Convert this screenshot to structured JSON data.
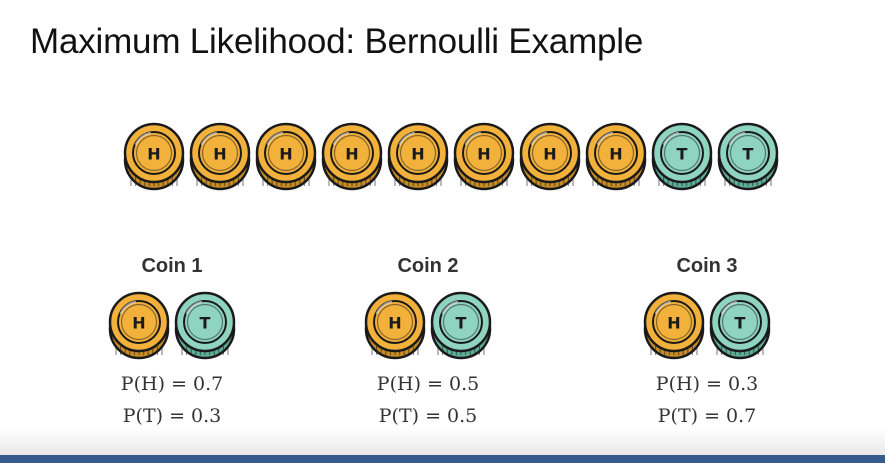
{
  "title": "Maximum Likelihood: Bernoulli Example",
  "sequence": [
    "H",
    "H",
    "H",
    "H",
    "H",
    "H",
    "H",
    "H",
    "T",
    "T"
  ],
  "coin_colors": {
    "heads_fill": "#f2b13b",
    "heads_rim": "#c98d26",
    "tails_fill": "#8ed4c0",
    "tails_rim": "#5fae98",
    "outline": "#1a1a1a"
  },
  "coins": [
    {
      "label": "Coin 1",
      "p_h": "P(H) = 0.7",
      "p_t": "P(T) = 0.3"
    },
    {
      "label": "Coin 2",
      "p_h": "P(H) = 0.5",
      "p_t": "P(T) = 0.5"
    },
    {
      "label": "Coin 3",
      "p_h": "P(H) = 0.3",
      "p_t": "P(T) = 0.7"
    }
  ],
  "footer_color": "#375a8c"
}
